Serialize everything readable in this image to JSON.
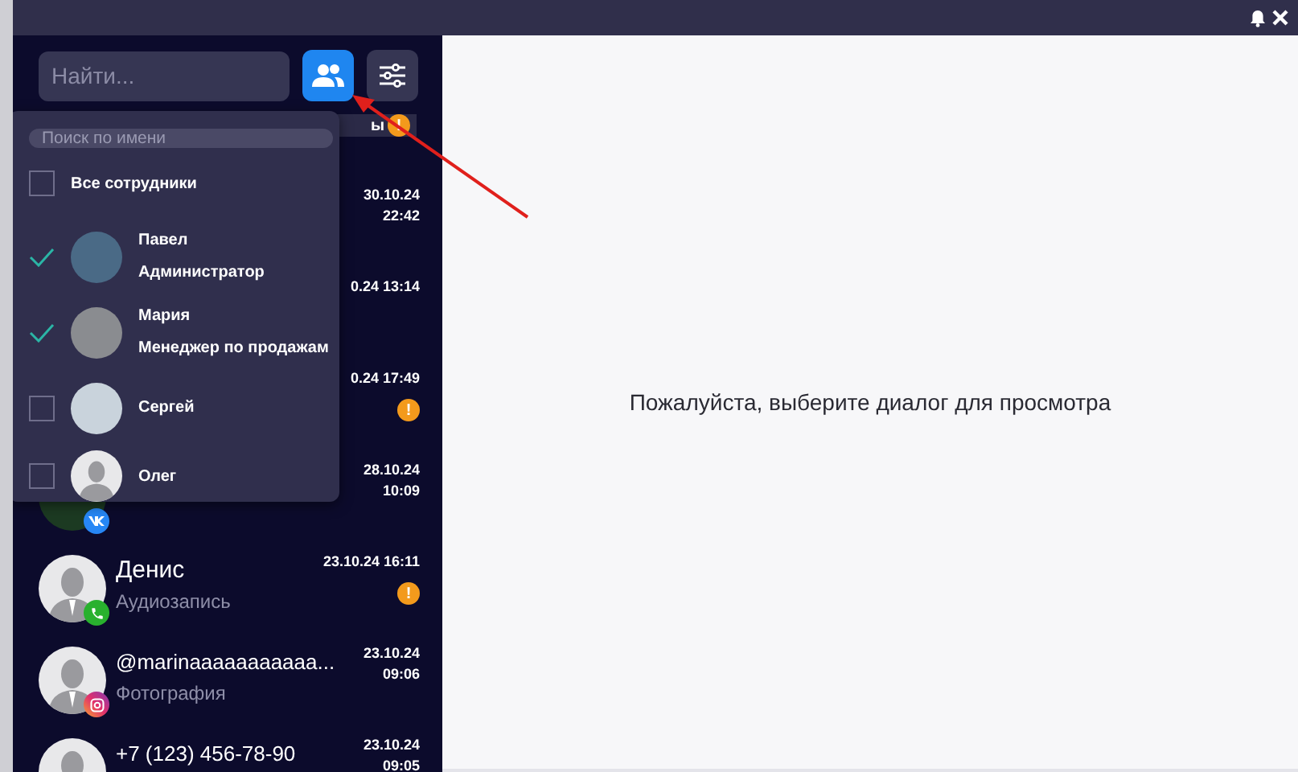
{
  "search": {
    "placeholder": "Найти..."
  },
  "toolbar_buttons": [
    {
      "kind": "employees",
      "selected": true
    },
    {
      "kind": "filters",
      "selected": false
    }
  ],
  "tabs": [
    {
      "label": "ы",
      "badge": "!"
    }
  ],
  "chats": [
    {
      "timestamp": [
        "30.10.24",
        "22:42"
      ]
    },
    {
      "timestamp": [
        "0.24 13:14"
      ]
    },
    {
      "timestamp": [
        "0.24 17:49"
      ],
      "badge": "!"
    },
    {
      "timestamp": [
        "28.10.24",
        "10:09"
      ],
      "channel_icon": {
        "kind": "vk"
      }
    },
    {
      "name": "Денис",
      "preview": "Аудиозапись",
      "timestamp": [
        "23.10.24 16:11"
      ],
      "channel_icon": {
        "kind": "phone"
      },
      "badge": "!"
    },
    {
      "name": "@marinaaaaaaaaaaa...",
      "preview": "Фотография",
      "timestamp": [
        "23.10.24",
        "09:06"
      ],
      "channel_icon": {
        "kind": "instagram"
      }
    },
    {
      "name": "+7 (123) 456-78-90",
      "timestamp": [
        "23.10.24",
        "09:05"
      ]
    }
  ],
  "employee_filter": {
    "placeholder": "Поиск по имени",
    "all": {
      "label": "Все сотрудники",
      "checked": false
    },
    "employees": [
      {
        "name": "Павел",
        "role": "Администратор",
        "checked": true,
        "kind": "photo"
      },
      {
        "name": "Мария",
        "role": "Менеджер по продажам",
        "checked": true,
        "kind": "photo"
      },
      {
        "name": "Сергей",
        "checked": false,
        "kind": "photo"
      },
      {
        "name": "Олег",
        "checked": false,
        "kind": "silhouette"
      }
    ]
  },
  "message": "Пожалуйста, выберите диалог для просмотра"
}
